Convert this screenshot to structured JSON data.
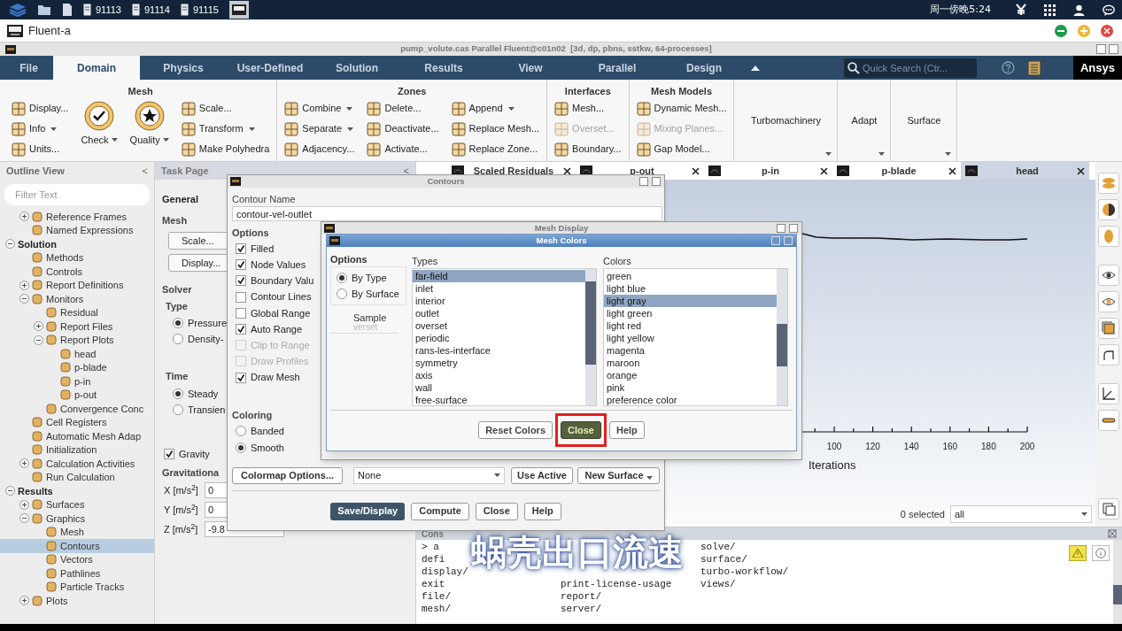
{
  "taskbar": {
    "tasks": [
      "91113",
      "91114",
      "91115"
    ],
    "clock": "周一傍晚5:24"
  },
  "app": {
    "title": "Fluent-a"
  },
  "window": {
    "title": "pump_volute.cas Parallel Fluent@c01n02  [3d, dp, pbns, sstkw, 64-processes]"
  },
  "ribbon_tabs": [
    {
      "label": "File",
      "selected": false
    },
    {
      "label": "Domain",
      "selected": true
    },
    {
      "label": "Physics",
      "selected": false
    },
    {
      "label": "User-Defined",
      "selected": false
    },
    {
      "label": "Solution",
      "selected": false
    },
    {
      "label": "Results",
      "selected": false
    },
    {
      "label": "View",
      "selected": false
    },
    {
      "label": "Parallel",
      "selected": false
    },
    {
      "label": "Design",
      "selected": false
    }
  ],
  "search": {
    "placeholder": "Quick Search (Ctr..."
  },
  "brand": "Ansys",
  "ribbon_groups": [
    {
      "title": "Mesh",
      "columns": [
        {
          "kind": "small",
          "items": [
            {
              "label": "Display...",
              "dropdown": false,
              "disabled": false
            },
            {
              "label": "Info",
              "dropdown": true,
              "disabled": false
            },
            {
              "label": "Units...",
              "dropdown": false,
              "disabled": false
            }
          ]
        },
        {
          "kind": "large",
          "items": [
            {
              "label": "Check",
              "dropdown": true,
              "disabled": false
            }
          ]
        },
        {
          "kind": "large",
          "items": [
            {
              "label": "Quality",
              "dropdown": true,
              "disabled": false
            }
          ]
        },
        {
          "kind": "small",
          "items": [
            {
              "label": "Scale...",
              "dropdown": false,
              "disabled": false
            },
            {
              "label": "Transform",
              "dropdown": true,
              "disabled": false
            },
            {
              "label": "Make Polyhedra",
              "dropdown": false,
              "disabled": false
            }
          ]
        }
      ]
    },
    {
      "title": "Zones",
      "columns": [
        {
          "kind": "small",
          "items": [
            {
              "label": "Combine",
              "dropdown": true,
              "disabled": false
            },
            {
              "label": "Separate",
              "dropdown": true,
              "disabled": false
            },
            {
              "label": "Adjacency...",
              "dropdown": false,
              "disabled": false
            }
          ]
        },
        {
          "kind": "small",
          "items": [
            {
              "label": "Delete...",
              "dropdown": false,
              "disabled": false
            },
            {
              "label": "Deactivate...",
              "dropdown": false,
              "disabled": false
            },
            {
              "label": "Activate...",
              "dropdown": false,
              "disabled": false
            }
          ]
        },
        {
          "kind": "small",
          "items": [
            {
              "label": "Append",
              "dropdown": true,
              "disabled": false
            },
            {
              "label": "Replace Mesh...",
              "dropdown": false,
              "disabled": false
            },
            {
              "label": "Replace Zone...",
              "dropdown": false,
              "disabled": false
            }
          ]
        }
      ]
    },
    {
      "title": "Interfaces",
      "columns": [
        {
          "kind": "small",
          "items": [
            {
              "label": "Mesh...",
              "dropdown": false,
              "disabled": false
            },
            {
              "label": "Overset...",
              "dropdown": false,
              "disabled": true
            },
            {
              "label": "Boundary...",
              "dropdown": false,
              "disabled": false
            }
          ]
        }
      ]
    },
    {
      "title": "Mesh Models",
      "columns": [
        {
          "kind": "small",
          "items": [
            {
              "label": "Dynamic Mesh...",
              "dropdown": false,
              "disabled": false
            },
            {
              "label": "Mixing Planes...",
              "dropdown": false,
              "disabled": true
            },
            {
              "label": "Gap Model...",
              "dropdown": false,
              "disabled": false
            }
          ]
        }
      ]
    }
  ],
  "ribbon_menus": [
    {
      "label": "Turbomachinery"
    },
    {
      "label": "Adapt"
    },
    {
      "label": "Surface"
    }
  ],
  "outline": {
    "title": "Outline View",
    "collapse": "<",
    "filter_placeholder": "Filter Text",
    "tree": [
      {
        "children": [
          {
            "label": "Reference Frames",
            "expanded": false,
            "selected": false
          },
          {
            "label": "Named Expressions",
            "selected": false
          }
        ]
      },
      {
        "label": "Solution",
        "expanded": true,
        "selected": false,
        "children": [
          {
            "label": "Methods",
            "selected": false
          },
          {
            "label": "Controls",
            "selected": false
          },
          {
            "label": "Report Definitions",
            "expanded": false,
            "selected": false
          },
          {
            "label": "Monitors",
            "expanded": true,
            "selected": false,
            "children": [
              {
                "label": "Residual",
                "selected": false
              },
              {
                "label": "Report Files",
                "expanded": false,
                "selected": false
              },
              {
                "label": "Report Plots",
                "expanded": true,
                "selected": false,
                "children": [
                  {
                    "label": "head",
                    "selected": false
                  },
                  {
                    "label": "p-blade",
                    "selected": false
                  },
                  {
                    "label": "p-in",
                    "selected": false
                  },
                  {
                    "label": "p-out",
                    "selected": false
                  }
                ]
              },
              {
                "label": "Convergence Conc",
                "selected": false
              }
            ]
          },
          {
            "label": "Cell Registers",
            "selected": false
          },
          {
            "label": "Automatic Mesh Adap",
            "selected": false
          },
          {
            "label": "Initialization",
            "selected": false
          },
          {
            "label": "Calculation Activities",
            "expanded": false,
            "selected": false
          },
          {
            "label": "Run Calculation",
            "selected": false
          }
        ]
      },
      {
        "label": "Results",
        "expanded": true,
        "selected": false,
        "children": [
          {
            "label": "Surfaces",
            "expanded": false,
            "selected": false
          },
          {
            "label": "Graphics",
            "expanded": true,
            "selected": false,
            "children": [
              {
                "label": "Mesh",
                "selected": false
              },
              {
                "label": "Contours",
                "selected": true
              },
              {
                "label": "Vectors",
                "selected": false
              },
              {
                "label": "Pathlines",
                "selected": false
              },
              {
                "label": "Particle Tracks",
                "selected": false
              }
            ]
          },
          {
            "label": "Plots",
            "expanded": false,
            "selected": false
          }
        ]
      }
    ]
  },
  "task_page": {
    "title": "Task Page",
    "collapse": "<",
    "general": "General",
    "mesh_label": "Mesh",
    "mesh_buttons": [
      "Scale...",
      "Display..."
    ],
    "solver_label": "Solver",
    "type": {
      "label": "Type",
      "options": [
        {
          "label": "Pressure",
          "selected": true
        },
        {
          "label": "Density-",
          "selected": false
        }
      ]
    },
    "time": {
      "label": "Time",
      "options": [
        {
          "label": "Steady",
          "selected": true
        },
        {
          "label": "Transien",
          "selected": false
        }
      ]
    },
    "gravity": {
      "label": "Gravity",
      "checked": true
    },
    "gravitational_label": "Gravitationa",
    "gravity_fields": [
      {
        "label": "X [m/s$^{2}$]",
        "value": "0"
      },
      {
        "label": "Y [m/s$^{2}$]",
        "value": "0"
      },
      {
        "label": "Z [m/s$^{2}$]",
        "value": "-9.8"
      }
    ]
  },
  "contours": {
    "title": "Contours",
    "name_label": "Contour Name",
    "name_value": "contour-vel-outlet",
    "options_label": "Options",
    "options": [
      {
        "label": "Filled",
        "checked": true,
        "disabled": false
      },
      {
        "label": "Node Values",
        "checked": true,
        "disabled": false
      },
      {
        "label": "Boundary Valu",
        "checked": true,
        "disabled": false
      },
      {
        "label": "Contour Lines",
        "checked": false,
        "disabled": false
      },
      {
        "label": "Global Range",
        "checked": false,
        "disabled": false
      },
      {
        "label": "Auto Range",
        "checked": true,
        "disabled": false
      },
      {
        "label": "Clip to Range",
        "checked": false,
        "disabled": true
      },
      {
        "label": "Draw Profiles",
        "checked": false,
        "disabled": true
      },
      {
        "label": "Draw Mesh",
        "checked": true,
        "disabled": false
      }
    ],
    "coloring_label": "Coloring",
    "coloring": [
      {
        "label": "Banded",
        "selected": false
      },
      {
        "label": "Smooth",
        "selected": true
      }
    ],
    "colormap_button": "Colormap Options...",
    "surface_filter": "None",
    "surface_buttons": [
      {
        "label": "Use Active",
        "dropdown": false
      },
      {
        "label": "New Surface",
        "dropdown": true
      }
    ],
    "buttons": [
      {
        "label": "Save/Display",
        "kind": "primary"
      },
      {
        "label": "Compute",
        "kind": "normal"
      },
      {
        "label": "Close",
        "kind": "normal"
      },
      {
        "label": "Help",
        "kind": "normal"
      }
    ]
  },
  "mesh_display": {
    "title": "Mesh Display"
  },
  "mesh_colors": {
    "title": "Mesh Colors",
    "options_label": "Options",
    "options": [
      {
        "label": "By Type",
        "selected": true
      },
      {
        "label": "By Surface",
        "selected": false
      }
    ],
    "sample_label": "Sample",
    "sample_text": "verset",
    "types_label": "Types",
    "types": [
      {
        "label": "far-field",
        "selected": true
      },
      {
        "label": "inlet",
        "selected": false
      },
      {
        "label": "interior",
        "selected": false
      },
      {
        "label": "outlet",
        "selected": false
      },
      {
        "label": "overset",
        "selected": false
      },
      {
        "label": "periodic",
        "selected": false
      },
      {
        "label": "rans-les-interface",
        "selected": false
      },
      {
        "label": "symmetry",
        "selected": false
      },
      {
        "label": "axis",
        "selected": false
      },
      {
        "label": "wall",
        "selected": false
      },
      {
        "label": "free-surface",
        "selected": false
      }
    ],
    "colors_label": "Colors",
    "colors": [
      {
        "label": "green",
        "selected": false
      },
      {
        "label": "light blue",
        "selected": false
      },
      {
        "label": "light gray",
        "selected": true
      },
      {
        "label": "light green",
        "selected": false
      },
      {
        "label": "light red",
        "selected": false
      },
      {
        "label": "light yellow",
        "selected": false
      },
      {
        "label": "magenta",
        "selected": false
      },
      {
        "label": "maroon",
        "selected": false
      },
      {
        "label": "orange",
        "selected": false
      },
      {
        "label": "pink",
        "selected": false
      },
      {
        "label": "preference color",
        "selected": false
      }
    ],
    "buttons": [
      {
        "label": "Reset Colors",
        "kind": "normal",
        "annotated": false
      },
      {
        "label": "Close",
        "kind": "hover",
        "annotated": true
      },
      {
        "label": "Help",
        "kind": "normal",
        "annotated": false
      }
    ]
  },
  "graphics": {
    "tabs": [
      {
        "label": "Scaled Residuals",
        "selected": false
      },
      {
        "label": "p-out",
        "selected": false
      },
      {
        "label": "p-in",
        "selected": false
      },
      {
        "label": "p-blade",
        "selected": false
      },
      {
        "label": "head",
        "selected": true
      }
    ],
    "plot": {
      "x_ticks": [
        "100",
        "120",
        "140",
        "160",
        "180",
        "200"
      ],
      "x_label": "Iterations"
    },
    "selection_count": "0 selected",
    "selection_filter": "all"
  },
  "console": {
    "title": "Cons",
    "rows": [
      {
        "c1": "> a",
        "c3": "solve/"
      },
      {
        "c1": "defi",
        "c3": "surface/"
      },
      {
        "c1": "display/",
        "c3": "turbo-workflow/"
      },
      {
        "c1": "exit",
        "c2": "print-license-usage",
        "c3": "views/"
      },
      {
        "c1": "file/",
        "c2": "report/"
      },
      {
        "c1": "mesh/",
        "c2": "server/"
      }
    ]
  },
  "subtitle": "蜗壳出口流速"
}
